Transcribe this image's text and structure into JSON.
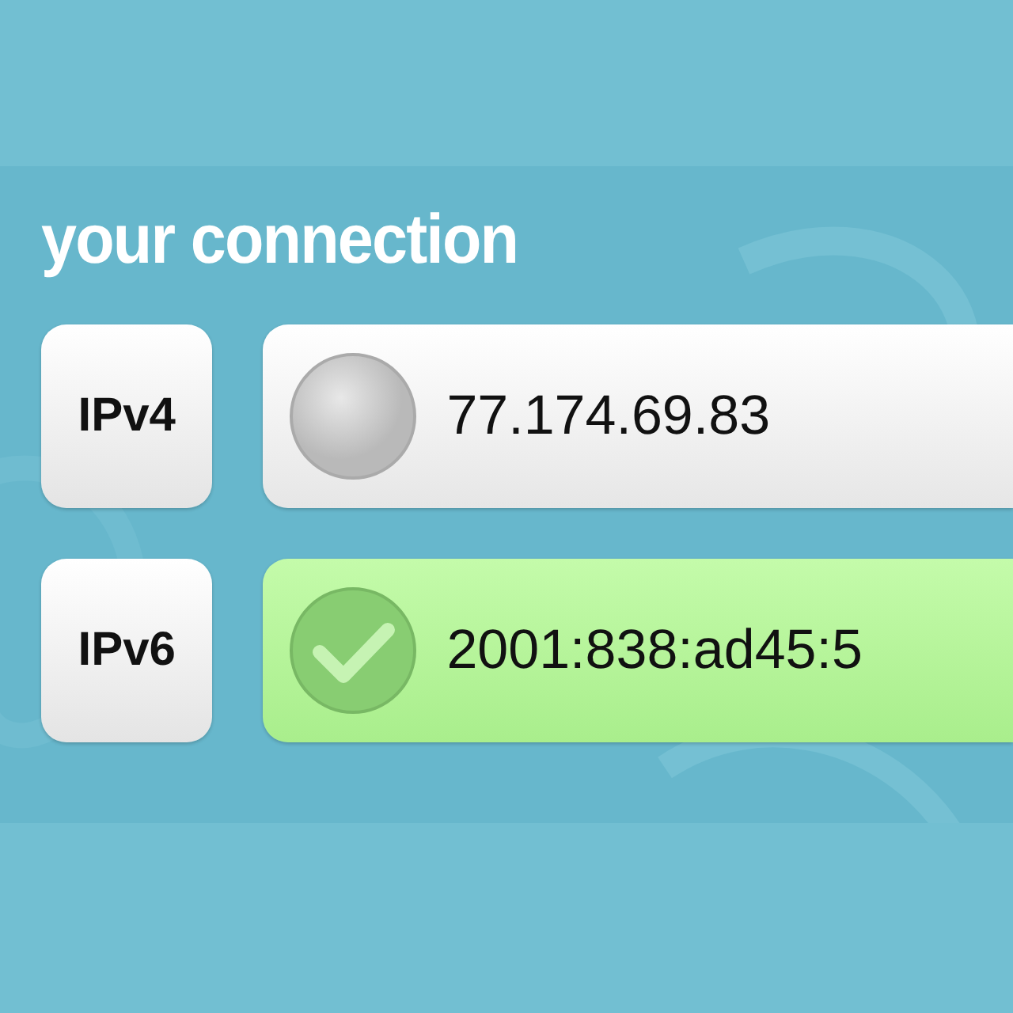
{
  "title": "your connection",
  "rows": [
    {
      "label": "IPv4",
      "address": "77.174.69.83",
      "ok": false
    },
    {
      "label": "IPv6",
      "address": "2001:838:ad45:5",
      "ok": true
    }
  ]
}
